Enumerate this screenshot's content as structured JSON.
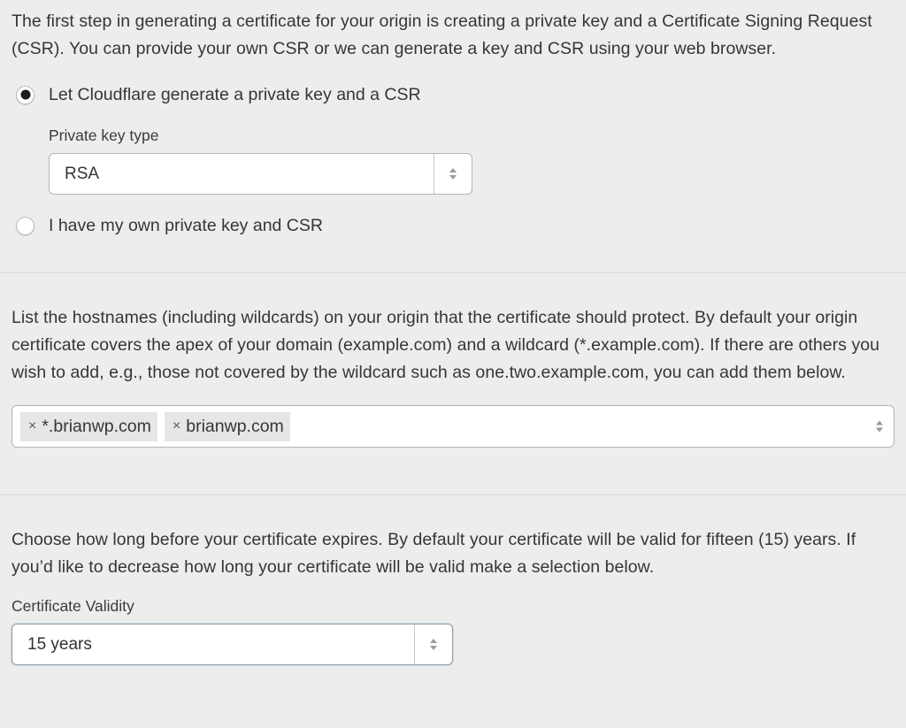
{
  "key_section": {
    "intro": "The first step in generating a certificate for your origin is creating a private key and a Certificate Signing Request (CSR). You can provide your own CSR or we can generate a key and CSR using your web browser.",
    "options": [
      {
        "label": "Let Cloudflare generate a private key and a CSR",
        "checked": true
      },
      {
        "label": "I have my own private key and CSR",
        "checked": false
      }
    ],
    "key_type_label": "Private key type",
    "key_type_value": "RSA"
  },
  "hostnames_section": {
    "intro": "List the hostnames (including wildcards) on your origin that the certificate should protect. By default your origin certificate covers the apex of your domain (example.com) and a wildcard (*.example.com). If there are others you wish to add, e.g., those not covered by the wildcard such as one.two.example.com, you can add them below.",
    "tags": [
      {
        "remove_glyph": "×",
        "label": "*.brianwp.com"
      },
      {
        "remove_glyph": "×",
        "label": "brianwp.com"
      }
    ]
  },
  "validity_section": {
    "intro": "Choose how long before your certificate expires. By default your certificate will be valid for fifteen (15) years. If you’d like to decrease how long your certificate will be valid make a selection below.",
    "label": "Certificate Validity",
    "value": "15 years"
  },
  "icons": {
    "select_arrows": "up-down-chevron-icon",
    "tag_remove": "close-icon",
    "text_cursor": "i-beam-cursor-icon"
  }
}
